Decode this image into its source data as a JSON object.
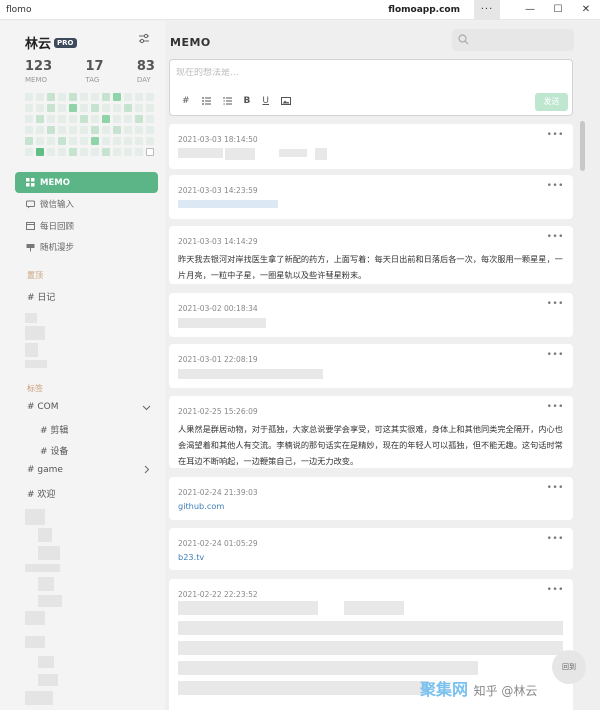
{
  "titlebar": {
    "app": "flomo",
    "site": "flomoapp.com",
    "more": "···"
  },
  "sidebar": {
    "user_name": "林云",
    "pro_badge": "PRO",
    "stats": [
      {
        "value": "123",
        "label": "MEMO"
      },
      {
        "value": "17",
        "label": "TAG"
      },
      {
        "value": "83",
        "label": "DAY"
      }
    ],
    "nav": [
      {
        "label": "MEMO",
        "icon": "grid-icon",
        "active": true
      },
      {
        "label": "微信输入",
        "icon": "chat-icon"
      },
      {
        "label": "每日回顾",
        "icon": "calendar-icon"
      },
      {
        "label": "随机漫步",
        "icon": "shuffle-icon"
      }
    ],
    "pinned_header": "置顶",
    "pinned_tags": [
      "# 日记"
    ],
    "tags_header": "标签",
    "tags": [
      {
        "label": "# COM",
        "expanded": true
      },
      {
        "label": "# 剪辑"
      },
      {
        "label": "# 设备"
      },
      {
        "label": "# game",
        "expanded": false
      },
      {
        "label": "# 欢迎"
      }
    ]
  },
  "main": {
    "title": "MEMO",
    "editor_placeholder": "现在的想法是...",
    "toolbar": [
      "#",
      "bullet-list-icon",
      "numbered-list-icon",
      "B",
      "U",
      "image-icon"
    ],
    "send_label": "发送",
    "memos": [
      {
        "date": "2021-03-03 18:14:50",
        "text": ""
      },
      {
        "date": "2021-03-03 14:23:59",
        "text": ""
      },
      {
        "date": "2021-03-03 14:14:29",
        "text": "昨天我去银河对岸找医生拿了新配的药方，上面写着：每天日出前和日落后各一次，每次服用一颗星星，一片月亮，一粒中子星，一圈星轨以及些许彗星粉末。"
      },
      {
        "date": "2021-03-02 00:18:34",
        "text": ""
      },
      {
        "date": "2021-03-01 22:08:19",
        "text": ""
      },
      {
        "date": "2021-02-25 15:26:09",
        "text": "人果然是群居动物，对于孤独，大家总说要学会享受，可这其实很难，身体上和其他同类完全隔开，内心也会渴望着和其他人有交流。李楠说的那句话实在是精妙，现在的年轻人可以孤独，但不能无趣。这句话时常在耳边不断响起，一边鞭策自己，一边无力改变。"
      },
      {
        "date": "2021-02-24 21:39:03",
        "link": "github.com"
      },
      {
        "date": "2021-02-24 01:05:29",
        "link": "b23.tv"
      },
      {
        "date": "2021-02-22 22:23:52",
        "text": ""
      }
    ]
  },
  "backtop_label": "回到",
  "watermark": {
    "brand": "聚集网",
    "author": "知乎 @林云"
  },
  "colors": {
    "accent": "#5bb587",
    "link": "#3f7fb9",
    "section": "#c9a07a"
  }
}
